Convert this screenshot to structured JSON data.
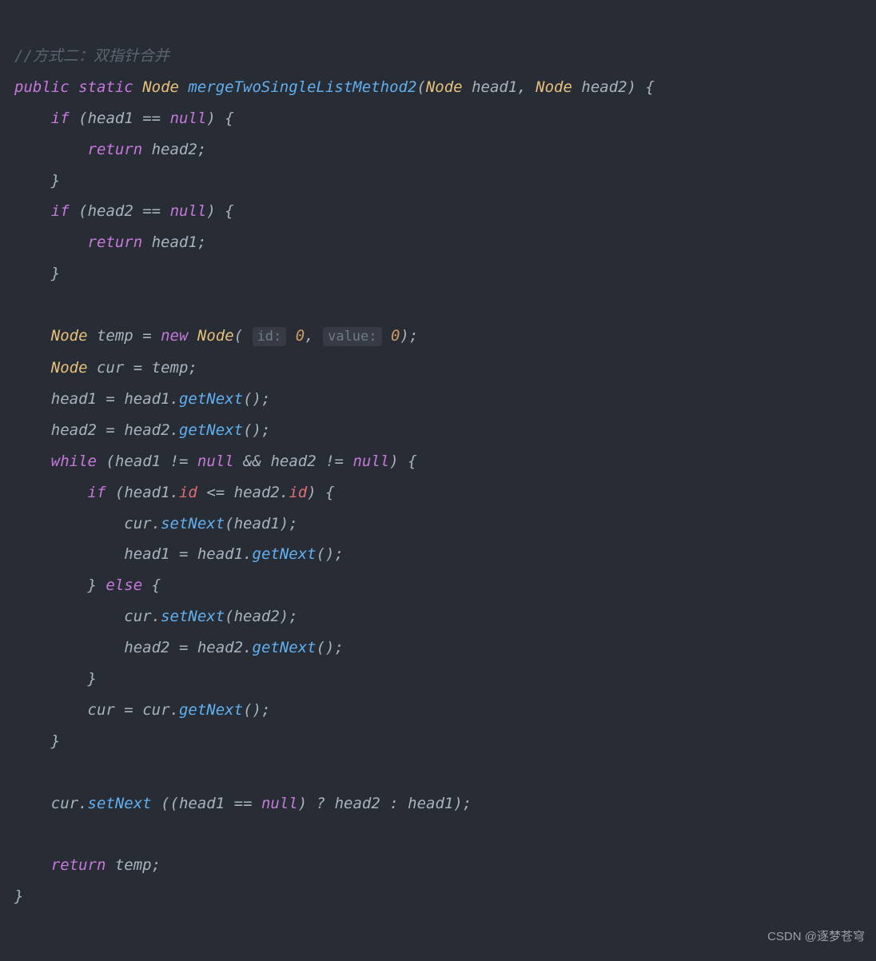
{
  "code": {
    "comment": "//方式二：双指针合并",
    "kw_public": "public",
    "kw_static": "static",
    "type_node": "Node",
    "method_name": "mergeTwoSingleListMethod2",
    "param_head1": "head1",
    "param_head2": "head2",
    "kw_if": "if",
    "op_eq": "==",
    "kw_null": "null",
    "kw_return": "return",
    "var_head2": "head2",
    "var_head1": "head1",
    "var_temp": "temp",
    "op_assign": "=",
    "kw_new": "new",
    "hint_id": "id:",
    "zero": "0",
    "comma": ",",
    "hint_value": "value:",
    "var_cur": "cur",
    "method_getNext": "getNext",
    "kw_while": "while",
    "op_ne": "!=",
    "op_and": "&&",
    "field_id": "id",
    "op_le": "<=",
    "method_setNext": "setNext",
    "kw_else": "else",
    "op_tern_q": "?",
    "op_tern_c": ":",
    "semicolon": ";",
    "lparen": "(",
    "rparen": ")",
    "lbrace": "{",
    "rbrace": "}",
    "dot": "."
  },
  "watermark": "CSDN @逐梦苍穹"
}
